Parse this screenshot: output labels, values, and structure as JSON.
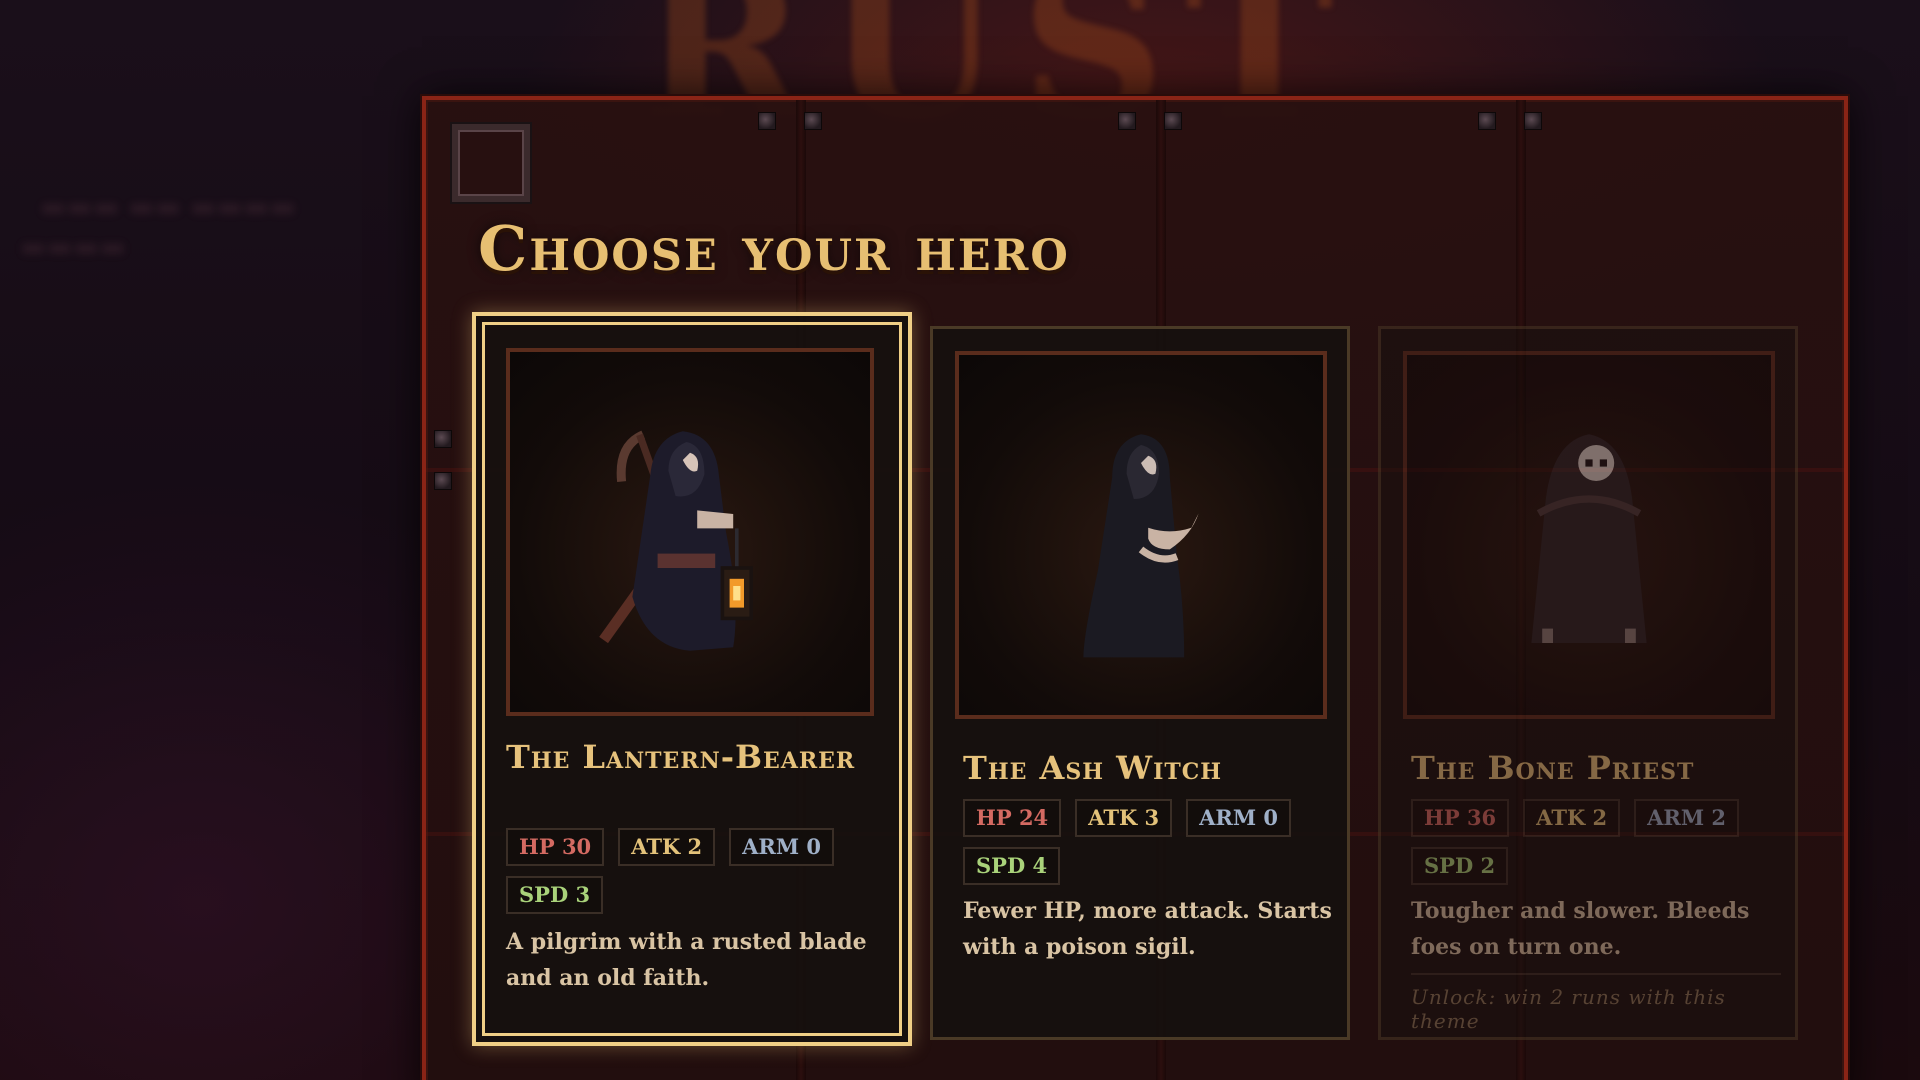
{
  "background": {
    "title_fragment": "RUST"
  },
  "panel": {
    "title": "Choose your hero"
  },
  "heroes": [
    {
      "name": "The Lantern-Bearer",
      "stats": {
        "hp": "HP 30",
        "atk": "ATK 2",
        "arm": "ARM 0",
        "spd": "SPD 3"
      },
      "description": "A pilgrim with a rusted blade and an old faith.",
      "selected": true,
      "locked": false
    },
    {
      "name": "The Ash Witch",
      "stats": {
        "hp": "HP 24",
        "atk": "ATK 3",
        "arm": "ARM 0",
        "spd": "SPD 4"
      },
      "description": "Fewer HP, more attack. Starts with a poison sigil.",
      "selected": false,
      "locked": false
    },
    {
      "name": "The Bone Priest",
      "stats": {
        "hp": "HP 36",
        "atk": "ATK 2",
        "arm": "ARM 2",
        "spd": "SPD 2"
      },
      "description": "Tougher and slower. Bleeds foes on turn one.",
      "unlock_text": "Unlock: win 2 runs with this theme",
      "selected": false,
      "locked": true
    }
  ],
  "colors": {
    "accent_gold": "#f0cf86",
    "panel_border": "#8a2416",
    "hp": "#d46a62",
    "atk": "#e3c27a",
    "arm": "#9fb0c8",
    "spd": "#a9d27a"
  },
  "icons": {
    "corner": "frame-corner-icon",
    "hero_1": "hooded-lantern-bearer-sprite",
    "hero_2": "hooded-ash-witch-sprite",
    "hero_3": "skull-priest-sprite"
  }
}
